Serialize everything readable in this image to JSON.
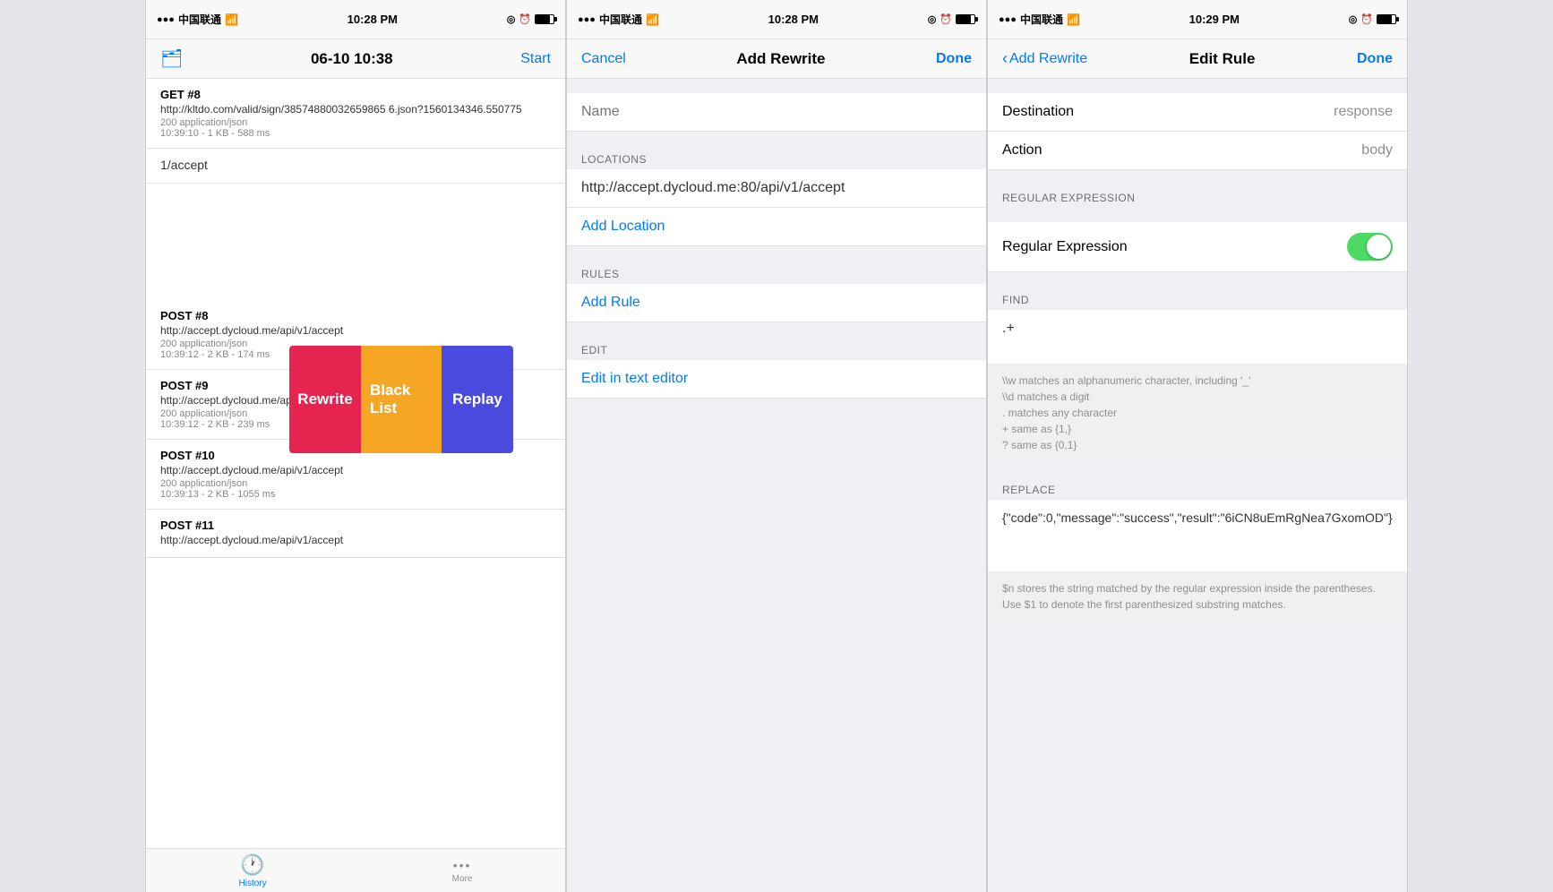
{
  "screens": {
    "history": {
      "status": {
        "carrier": "中国联通",
        "wifi": true,
        "time": "10:28 PM",
        "battery": 80
      },
      "nav": {
        "title": "06-10 10:38",
        "action": "Start",
        "icon": "folder"
      },
      "requests": [
        {
          "method": "GET  #8",
          "url": "http://kltdo.com/valid/sign/38574880032659865 6.json?1560134346.550775",
          "meta": "200  application/json",
          "time": "10:39:10 - 1 KB - 588 ms"
        },
        {
          "method": "1/accept",
          "url": "",
          "meta": "",
          "time": "",
          "contextMenu": true
        },
        {
          "method": "POST  #8",
          "url": "http://accept.dycloud.me/api/v1/accept",
          "meta": "200  application/json",
          "time": "10:39:12 - 2 KB - 174 ms"
        },
        {
          "method": "POST  #9",
          "url": "http://accept.dycloud.me/api/v1/accept",
          "meta": "200  application/json",
          "time": "10:39:12 - 2 KB - 239 ms"
        },
        {
          "method": "POST  #10",
          "url": "http://accept.dycloud.me/api/v1/accept",
          "meta": "200  application/json",
          "time": "10:39:13 - 2 KB - 1055 ms"
        },
        {
          "method": "POST  #11",
          "url": "http://accept.dycloud.me/api/v1/accept",
          "meta": "",
          "time": ""
        }
      ],
      "contextMenu": {
        "rewrite": "Rewrite",
        "blacklist": "Black List",
        "replay": "Replay"
      },
      "tabs": [
        {
          "label": "History",
          "active": true,
          "icon": "🕐"
        },
        {
          "label": "More",
          "active": false,
          "icon": "•••"
        }
      ]
    },
    "addRewrite": {
      "status": {
        "carrier": "中国联通",
        "wifi": true,
        "time": "10:28 PM",
        "battery": 80
      },
      "nav": {
        "title": "Add Rewrite",
        "cancel": "Cancel",
        "done": "Done"
      },
      "name_placeholder": "Name",
      "sections": {
        "locations": {
          "header": "LOCATIONS",
          "url": "http://accept.dycloud.me:80/api/v1/accept",
          "add": "Add Location"
        },
        "rules": {
          "header": "RULES",
          "add": "Add Rule"
        },
        "edit": {
          "header": "EDIT",
          "link": "Edit in text editor"
        }
      }
    },
    "editRule": {
      "status": {
        "carrier": "中国联通",
        "wifi": true,
        "time": "10:29 PM",
        "battery": 80
      },
      "nav": {
        "back": "Add Rewrite",
        "title": "Edit Rule",
        "done": "Done"
      },
      "destination_label": "Destination",
      "destination_value": "response",
      "action_label": "Action",
      "action_value": "body",
      "regex_section": "REGULAR EXPRESSION",
      "regex_label": "Regular Expression",
      "regex_enabled": true,
      "find_section": "FIND",
      "find_value": ".+",
      "find_hints": [
        "\\w matches an alphanumeric character, including '_'",
        "\\d matches a digit",
        ". matches any character",
        "+ same as {1,}",
        "? same as {0,1}"
      ],
      "replace_section": "REPLACE",
      "replace_value": "{\"code\":0,\"message\":\"success\",\"result\":\"6iCN8uEmRgNea7GxomOD\"}",
      "replace_hint": "$n stores the string matched by the regular expression inside the parentheses. Use $1 to denote the first parenthesized substring matches."
    }
  }
}
